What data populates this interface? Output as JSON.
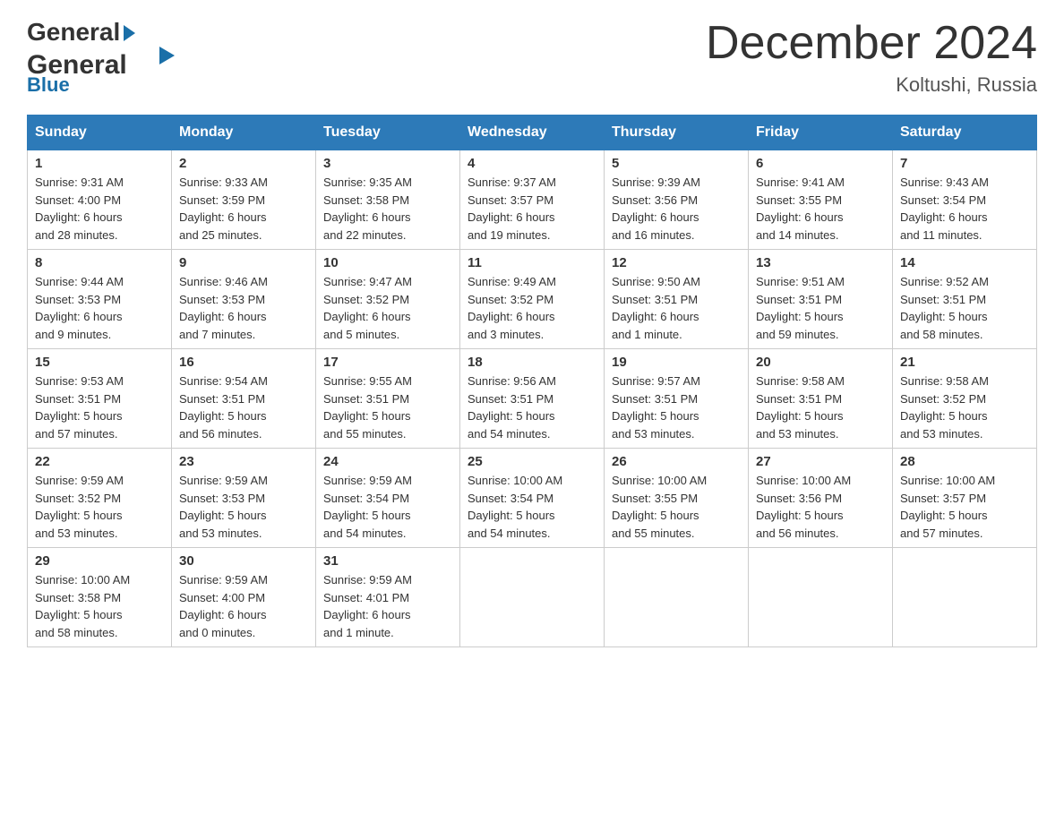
{
  "header": {
    "logo_general": "General",
    "logo_blue": "Blue",
    "month_title": "December 2024",
    "location": "Koltushi, Russia"
  },
  "days_of_week": [
    "Sunday",
    "Monday",
    "Tuesday",
    "Wednesday",
    "Thursday",
    "Friday",
    "Saturday"
  ],
  "weeks": [
    [
      {
        "day": "1",
        "sunrise": "9:31 AM",
        "sunset": "4:00 PM",
        "daylight": "6 hours and 28 minutes."
      },
      {
        "day": "2",
        "sunrise": "9:33 AM",
        "sunset": "3:59 PM",
        "daylight": "6 hours and 25 minutes."
      },
      {
        "day": "3",
        "sunrise": "9:35 AM",
        "sunset": "3:58 PM",
        "daylight": "6 hours and 22 minutes."
      },
      {
        "day": "4",
        "sunrise": "9:37 AM",
        "sunset": "3:57 PM",
        "daylight": "6 hours and 19 minutes."
      },
      {
        "day": "5",
        "sunrise": "9:39 AM",
        "sunset": "3:56 PM",
        "daylight": "6 hours and 16 minutes."
      },
      {
        "day": "6",
        "sunrise": "9:41 AM",
        "sunset": "3:55 PM",
        "daylight": "6 hours and 14 minutes."
      },
      {
        "day": "7",
        "sunrise": "9:43 AM",
        "sunset": "3:54 PM",
        "daylight": "6 hours and 11 minutes."
      }
    ],
    [
      {
        "day": "8",
        "sunrise": "9:44 AM",
        "sunset": "3:53 PM",
        "daylight": "6 hours and 9 minutes."
      },
      {
        "day": "9",
        "sunrise": "9:46 AM",
        "sunset": "3:53 PM",
        "daylight": "6 hours and 7 minutes."
      },
      {
        "day": "10",
        "sunrise": "9:47 AM",
        "sunset": "3:52 PM",
        "daylight": "6 hours and 5 minutes."
      },
      {
        "day": "11",
        "sunrise": "9:49 AM",
        "sunset": "3:52 PM",
        "daylight": "6 hours and 3 minutes."
      },
      {
        "day": "12",
        "sunrise": "9:50 AM",
        "sunset": "3:51 PM",
        "daylight": "6 hours and 1 minute."
      },
      {
        "day": "13",
        "sunrise": "9:51 AM",
        "sunset": "3:51 PM",
        "daylight": "5 hours and 59 minutes."
      },
      {
        "day": "14",
        "sunrise": "9:52 AM",
        "sunset": "3:51 PM",
        "daylight": "5 hours and 58 minutes."
      }
    ],
    [
      {
        "day": "15",
        "sunrise": "9:53 AM",
        "sunset": "3:51 PM",
        "daylight": "5 hours and 57 minutes."
      },
      {
        "day": "16",
        "sunrise": "9:54 AM",
        "sunset": "3:51 PM",
        "daylight": "5 hours and 56 minutes."
      },
      {
        "day": "17",
        "sunrise": "9:55 AM",
        "sunset": "3:51 PM",
        "daylight": "5 hours and 55 minutes."
      },
      {
        "day": "18",
        "sunrise": "9:56 AM",
        "sunset": "3:51 PM",
        "daylight": "5 hours and 54 minutes."
      },
      {
        "day": "19",
        "sunrise": "9:57 AM",
        "sunset": "3:51 PM",
        "daylight": "5 hours and 53 minutes."
      },
      {
        "day": "20",
        "sunrise": "9:58 AM",
        "sunset": "3:51 PM",
        "daylight": "5 hours and 53 minutes."
      },
      {
        "day": "21",
        "sunrise": "9:58 AM",
        "sunset": "3:52 PM",
        "daylight": "5 hours and 53 minutes."
      }
    ],
    [
      {
        "day": "22",
        "sunrise": "9:59 AM",
        "sunset": "3:52 PM",
        "daylight": "5 hours and 53 minutes."
      },
      {
        "day": "23",
        "sunrise": "9:59 AM",
        "sunset": "3:53 PM",
        "daylight": "5 hours and 53 minutes."
      },
      {
        "day": "24",
        "sunrise": "9:59 AM",
        "sunset": "3:54 PM",
        "daylight": "5 hours and 54 minutes."
      },
      {
        "day": "25",
        "sunrise": "10:00 AM",
        "sunset": "3:54 PM",
        "daylight": "5 hours and 54 minutes."
      },
      {
        "day": "26",
        "sunrise": "10:00 AM",
        "sunset": "3:55 PM",
        "daylight": "5 hours and 55 minutes."
      },
      {
        "day": "27",
        "sunrise": "10:00 AM",
        "sunset": "3:56 PM",
        "daylight": "5 hours and 56 minutes."
      },
      {
        "day": "28",
        "sunrise": "10:00 AM",
        "sunset": "3:57 PM",
        "daylight": "5 hours and 57 minutes."
      }
    ],
    [
      {
        "day": "29",
        "sunrise": "10:00 AM",
        "sunset": "3:58 PM",
        "daylight": "5 hours and 58 minutes."
      },
      {
        "day": "30",
        "sunrise": "9:59 AM",
        "sunset": "4:00 PM",
        "daylight": "6 hours and 0 minutes."
      },
      {
        "day": "31",
        "sunrise": "9:59 AM",
        "sunset": "4:01 PM",
        "daylight": "6 hours and 1 minute."
      },
      null,
      null,
      null,
      null
    ]
  ],
  "labels": {
    "sunrise": "Sunrise:",
    "sunset": "Sunset:",
    "daylight": "Daylight:"
  }
}
